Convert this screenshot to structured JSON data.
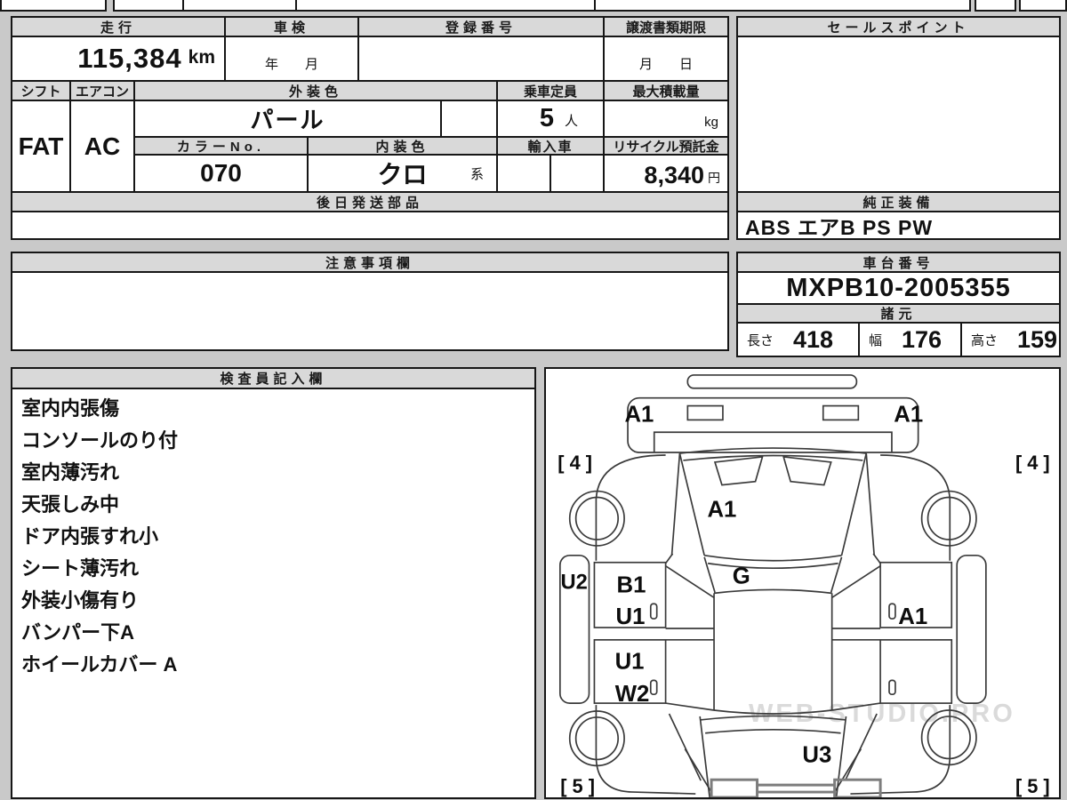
{
  "top_table": {
    "mileage_header": "走行",
    "shaken_header": "車検",
    "registration_header": "登録番号",
    "deadline_header": "譲渡書類期限",
    "mileage_value": "115,384",
    "mileage_unit": "km",
    "shaken_value": "年　　月",
    "deadline_value": "月　　日",
    "shift_header": "シフト",
    "aircon_header": "エアコン",
    "exterior_color_header": "外装色",
    "capacity_header": "乗車定員",
    "max_load_header": "最大積載量",
    "shift_value": "FAT",
    "aircon_value": "AC",
    "exterior_color_value": "パール",
    "capacity_value": "5",
    "capacity_unit": "人",
    "max_load_unit": "kg",
    "color_no_header": "カラーNo.",
    "interior_color_header": "内装色",
    "import_header": "輸入車",
    "recycle_header": "リサイクル預託金",
    "color_no_value": "070",
    "interior_color_value": "クロ",
    "interior_color_suffix": "系",
    "recycle_value": "8,340",
    "recycle_unit": "円",
    "later_parts_header": "後日発送部品"
  },
  "sales_point": {
    "header": "セールスポイント"
  },
  "equipment": {
    "header": "純正装備",
    "value": "ABS エアB PS PW"
  },
  "notes": {
    "header": "注意事項欄"
  },
  "chassis": {
    "header": "車台番号",
    "value": "MXPB10-2005355"
  },
  "specs": {
    "header": "諸元",
    "length_label": "長さ",
    "length_value": "418",
    "width_label": "幅",
    "width_value": "176",
    "height_label": "高さ",
    "height_value": "159"
  },
  "inspector": {
    "header": "検査員記入欄",
    "lines": [
      "室内内張傷",
      "コンソールのり付",
      "室内薄汚れ",
      "天張しみ中",
      "ドア内張すれ小",
      "シート薄汚れ",
      "外装小傷有り",
      "バンパー下A",
      "ホイールカバー A"
    ]
  },
  "diagram": {
    "labels": {
      "front_bumper_left": "A1",
      "front_bumper_right": "A1",
      "tire_front_left": "[ 4 ]",
      "tire_front_right": "[ 4 ]",
      "tire_rear_left": "[ 5 ]",
      "tire_rear_right": "[ 5 ]",
      "hood": "A1",
      "glass": "G",
      "rocker_left": "U2",
      "door_front_left_1": "B1",
      "door_front_left_2": "U1",
      "door_rear_left_1": "U1",
      "door_rear_left_2": "W2",
      "door_front_right": "A1",
      "rear_gate": "U3"
    },
    "watermark": "WEB-STUDIO.PRO"
  },
  "colors": {
    "header_fill": "#d9d9d9",
    "border": "#161616",
    "page_bg": "#c9c9c9"
  }
}
